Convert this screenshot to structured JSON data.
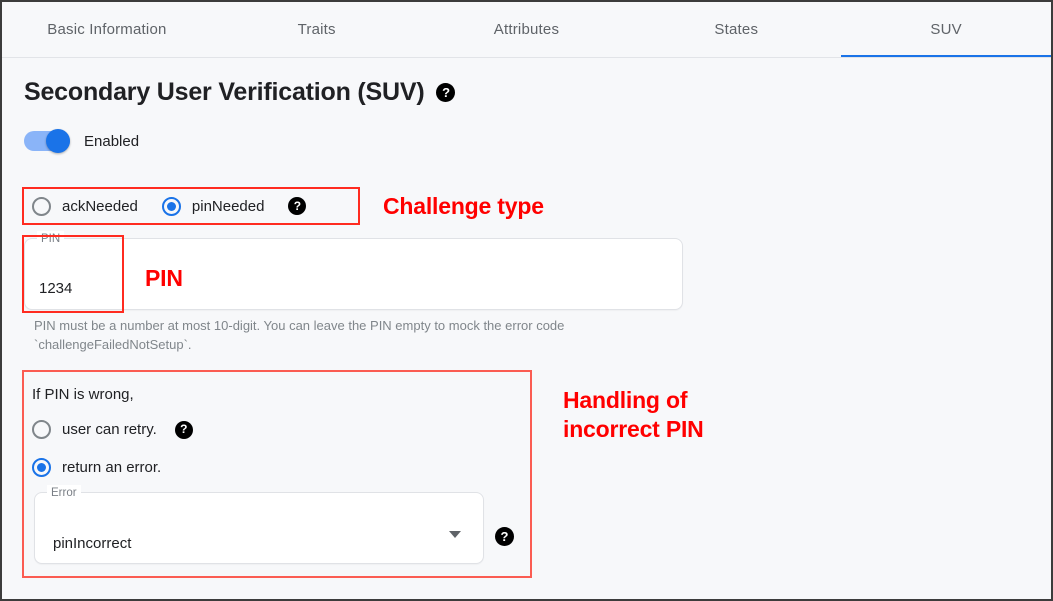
{
  "tabs": [
    {
      "label": "Basic Information",
      "active": false
    },
    {
      "label": "Traits",
      "active": false
    },
    {
      "label": "Attributes",
      "active": false
    },
    {
      "label": "States",
      "active": false
    },
    {
      "label": "SUV",
      "active": true
    }
  ],
  "page": {
    "title": "Secondary User Verification (SUV)",
    "title_help_icon": "help-icon"
  },
  "enabled_toggle": {
    "label": "Enabled",
    "state": "on"
  },
  "challenge_type": {
    "options": [
      {
        "label": "ackNeeded",
        "selected": false
      },
      {
        "label": "pinNeeded",
        "selected": true
      }
    ],
    "help_icon": "help-icon",
    "annotation": "Challenge type"
  },
  "pin": {
    "legend": "PIN",
    "value": "1234",
    "annotation": "PIN",
    "helper_text": "PIN must be a number at most 10-digit. You can leave the PIN empty to mock the error code `challengeFailedNotSetup`."
  },
  "wrong_pin": {
    "title": "If PIN is wrong,",
    "options": [
      {
        "label": "user can retry.",
        "selected": false,
        "help_icon": "help-icon"
      },
      {
        "label": "return an error.",
        "selected": true
      }
    ],
    "error_select": {
      "legend": "Error",
      "value": "pinIncorrect",
      "caret_icon": "chevron-down-icon",
      "help_icon": "help-icon"
    },
    "annotation_line1": "Handling of",
    "annotation_line2": "incorrect PIN"
  },
  "colors": {
    "accent_blue": "#1a73e8",
    "toggle_track": "#8ab4f8",
    "annotation_red": "#ff0000",
    "box_red": "#ff2b20",
    "text_primary": "#202124",
    "text_secondary": "#5f6368",
    "background": "#f7f8fa"
  }
}
